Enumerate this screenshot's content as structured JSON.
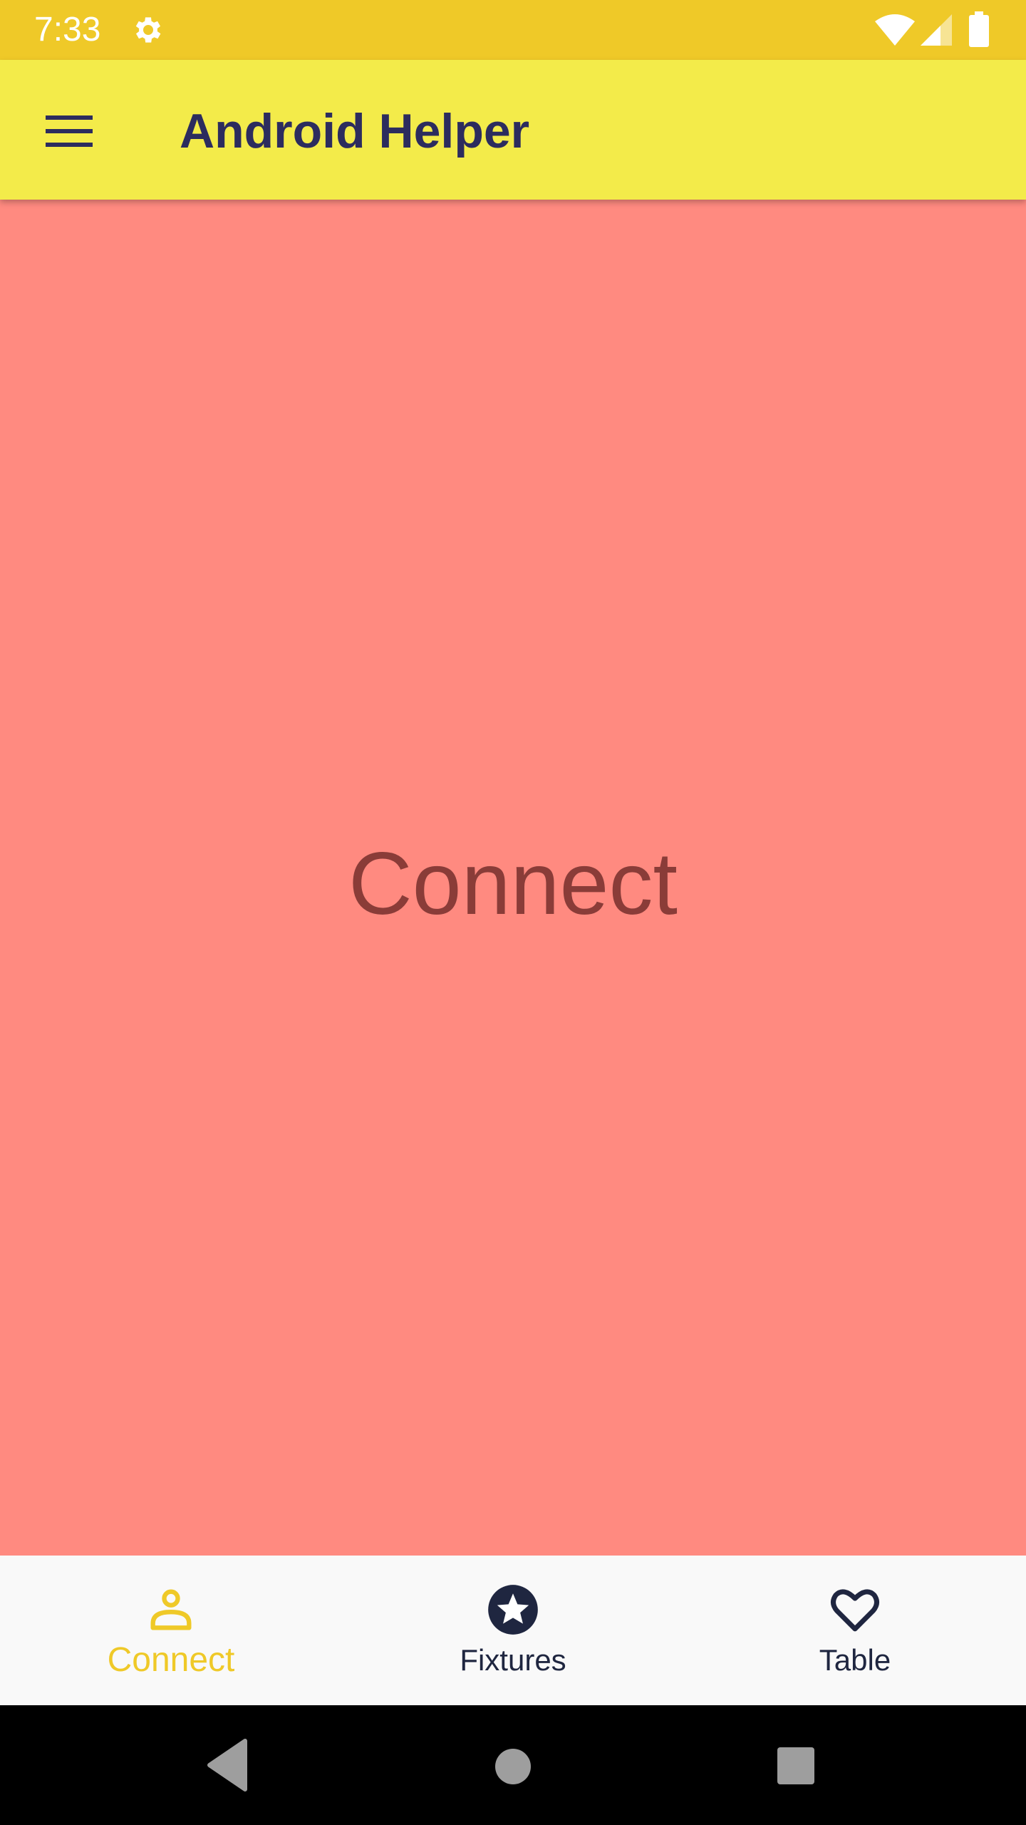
{
  "status_bar": {
    "time": "7:33",
    "icons": [
      "gear-icon",
      "wifi-icon",
      "cell-signal-icon",
      "battery-icon"
    ]
  },
  "app_bar": {
    "menu_icon": "menu-icon",
    "title": "Android Helper"
  },
  "content": {
    "label": "Connect"
  },
  "bottom_nav": {
    "items": [
      {
        "label": "Connect",
        "icon": "person-icon",
        "active": true
      },
      {
        "label": "Fixtures",
        "icon": "star-icon",
        "active": false
      },
      {
        "label": "Table",
        "icon": "heart-icon",
        "active": false
      }
    ]
  },
  "system_nav": {
    "icons": [
      "back-icon",
      "home-icon",
      "recents-icon"
    ]
  },
  "colors": {
    "status_bar": "#efc928",
    "app_bar": "#f3eb4a",
    "title_text": "#2c2c5e",
    "content_bg": "#ff8a80",
    "content_text": "#8a3c38",
    "nav_bg": "#f9f9f9",
    "nav_active": "#efc928",
    "nav_inactive": "#1f2640"
  }
}
